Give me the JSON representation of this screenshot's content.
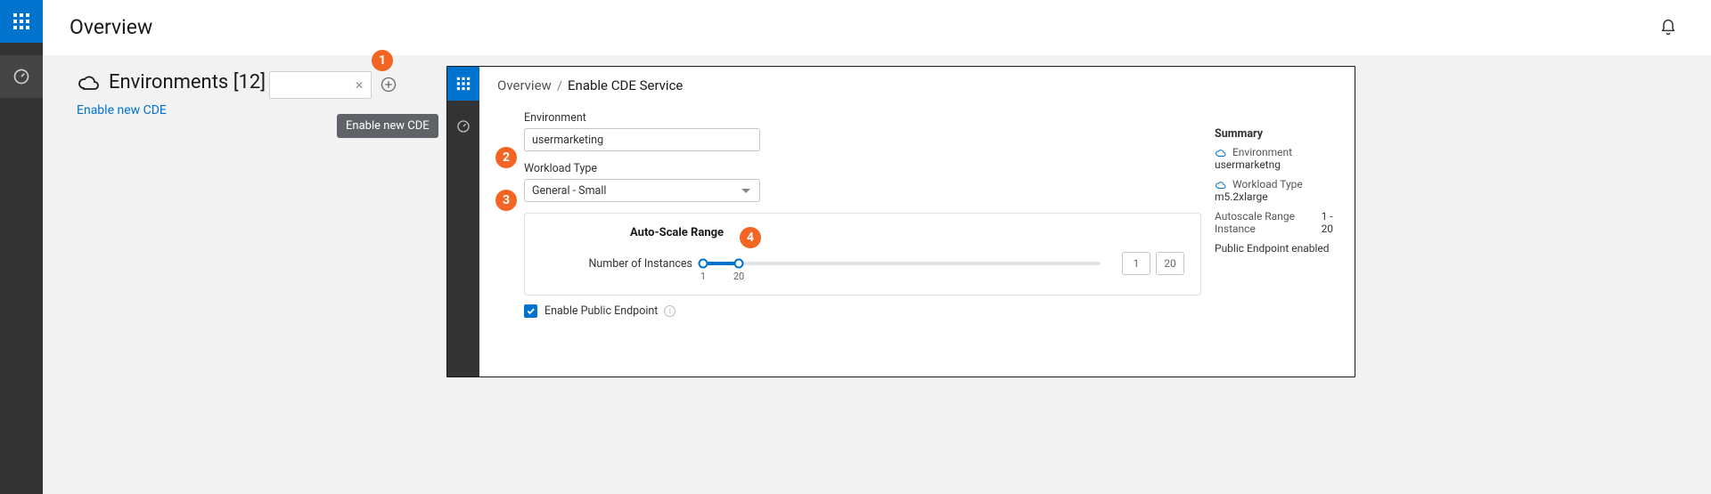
{
  "outer": {
    "page_title": "Overview",
    "environments": {
      "heading": "Environments [12]",
      "enable_link": "Enable new CDE",
      "search_value": "",
      "add_tooltip": "Enable new CDE"
    }
  },
  "markers": {
    "m1": "1",
    "m2": "2",
    "m3": "3",
    "m4": "4"
  },
  "inner": {
    "breadcrumb": {
      "root": "Overview",
      "leaf": "Enable CDE Service",
      "sep": "/"
    },
    "form": {
      "env_label": "Environment",
      "env_value": "usermarketing",
      "workload_label": "Workload Type",
      "workload_value": "General - Small",
      "scale_title": "Auto-Scale Range",
      "instances_label": "Number of Instances",
      "instances_min": "1",
      "instances_max": "20",
      "checkbox_label": "Enable Public Endpoint"
    },
    "summary": {
      "heading": "Summary",
      "env_k": "Environment",
      "env_v": "usermarketng",
      "wl_k": "Workload Type",
      "wl_v": "m5.2xlarge",
      "scale_k": "Autoscale Range Instance",
      "scale_v": "1 - 20",
      "endpoint": "Public Endpoint enabled"
    }
  }
}
